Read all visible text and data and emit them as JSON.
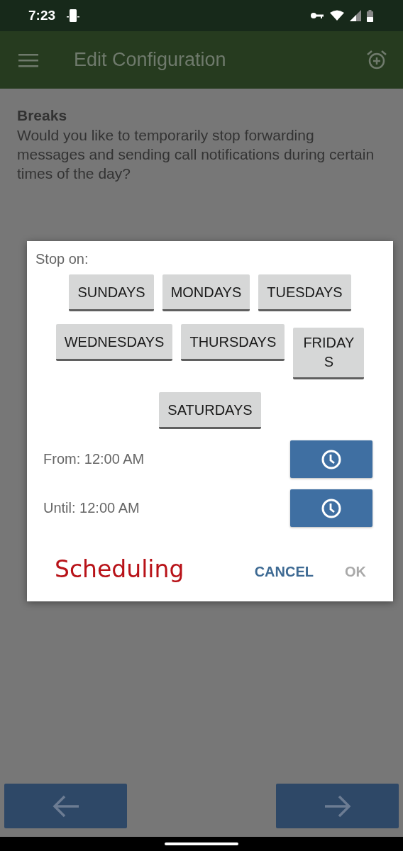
{
  "status_bar": {
    "time": "7:23"
  },
  "app_bar": {
    "title": "Edit Configuration"
  },
  "section": {
    "title": "Breaks",
    "description": "Would you like to temporarily stop forwarding messages and sending call notifications during certain times of the day?"
  },
  "dialog": {
    "label": "Stop on:",
    "days": [
      {
        "label": "SUNDAYS"
      },
      {
        "label": "MONDAYS"
      },
      {
        "label": "TUESDAYS"
      },
      {
        "label": "WEDNESDAYS"
      },
      {
        "label": "THURSDAYS"
      },
      {
        "label": "FRIDAYS"
      },
      {
        "label": "SATURDAYS"
      }
    ],
    "times": [
      {
        "label": "From: 12:00 AM"
      },
      {
        "label": "Until: 12:00 AM"
      }
    ],
    "caption": "Scheduling",
    "actions": [
      {
        "label": "CANCEL",
        "disabled": false
      },
      {
        "label": "OK",
        "disabled": true
      }
    ]
  }
}
